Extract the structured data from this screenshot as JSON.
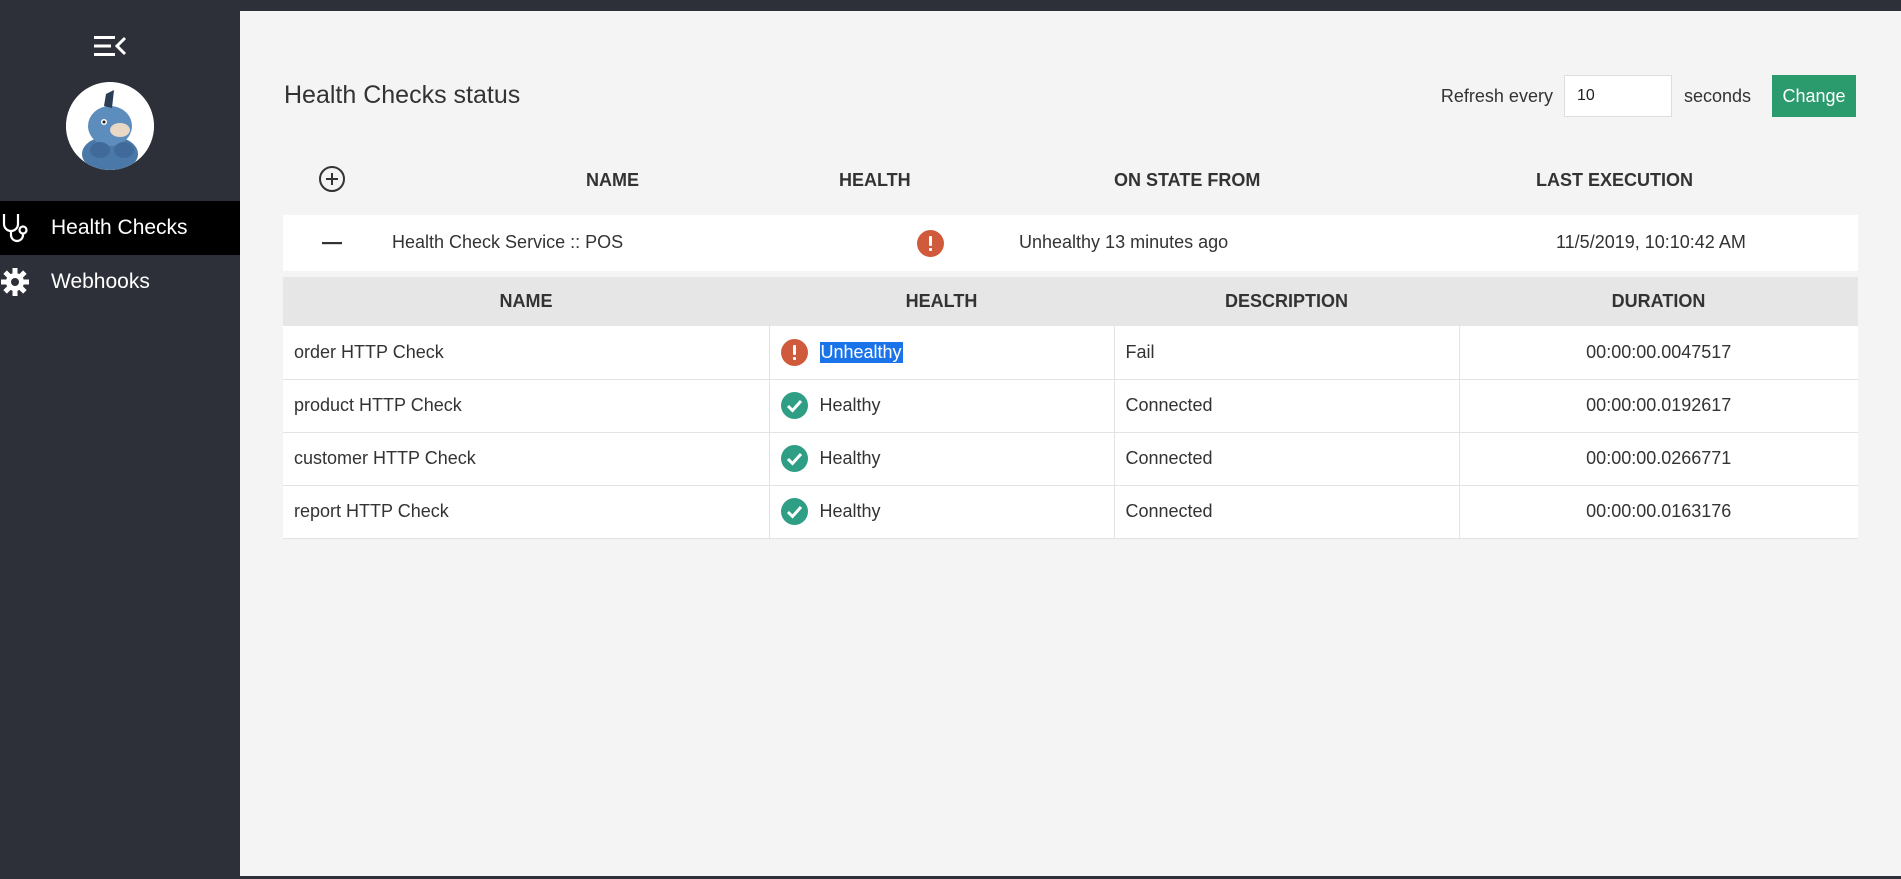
{
  "sidebar": {
    "menu_icon": "menu-collapse-icon",
    "items": [
      {
        "label": "Health Checks",
        "icon": "stethoscope-icon",
        "active": true
      },
      {
        "label": "Webhooks",
        "icon": "gear-icon",
        "active": false
      }
    ]
  },
  "header": {
    "title": "Health Checks status",
    "refresh_label": "Refresh every",
    "refresh_value": "10",
    "seconds_label": "seconds",
    "change_label": "Change"
  },
  "table": {
    "columns": {
      "name": "NAME",
      "health": "HEALTH",
      "on_state_from": "ON STATE FROM",
      "last_execution": "LAST EXECUTION"
    },
    "service": {
      "name": "Health Check Service :: POS",
      "health_icon": "error-icon",
      "on_state_from": "Unhealthy 13 minutes ago",
      "last_execution": "11/5/2019, 10:10:42 AM"
    }
  },
  "details": {
    "columns": {
      "name": "NAME",
      "health": "HEALTH",
      "description": "DESCRIPTION",
      "duration": "DURATION"
    },
    "rows": [
      {
        "name": "order HTTP Check",
        "health": "Unhealthy",
        "description": "Fail",
        "duration": "00:00:00.0047517"
      },
      {
        "name": "product HTTP Check",
        "health": "Healthy",
        "description": "Connected",
        "duration": "00:00:00.0192617"
      },
      {
        "name": "customer HTTP Check",
        "health": "Healthy",
        "description": "Connected",
        "duration": "00:00:00.0266771"
      },
      {
        "name": "report HTTP Check",
        "health": "Healthy",
        "description": "Connected",
        "duration": "00:00:00.0163176"
      }
    ]
  },
  "colors": {
    "accent": "#2b9a6c",
    "unhealthy": "#d05b3c",
    "healthy": "#2e9e84",
    "sidebar": "#2d3038",
    "selection": "#1a73e8"
  }
}
